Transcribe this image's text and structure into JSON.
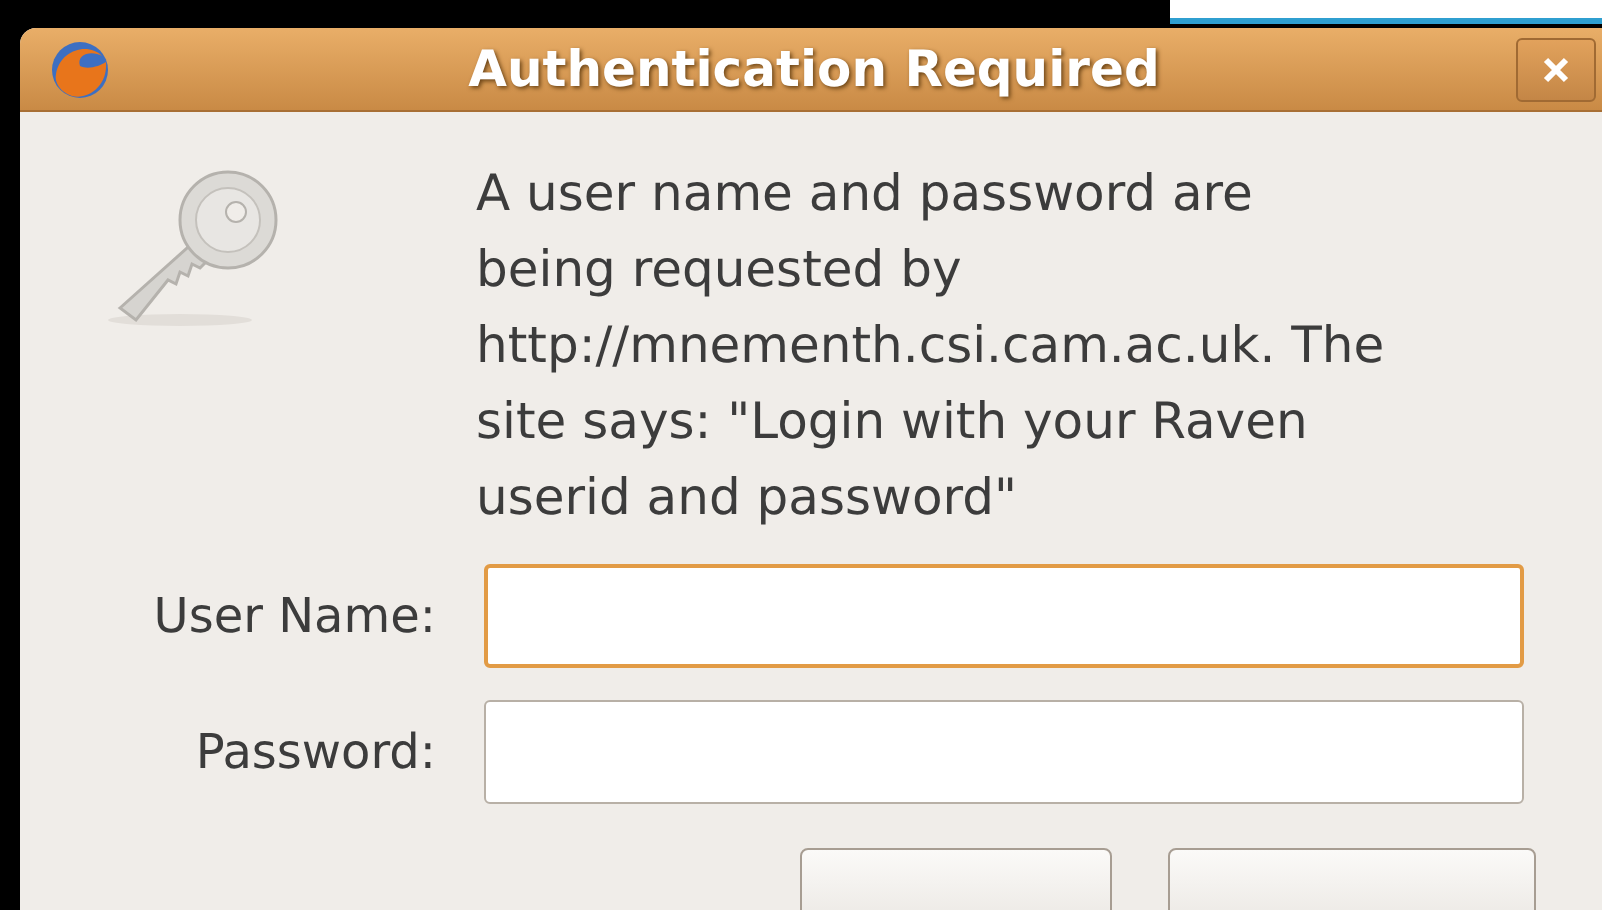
{
  "window": {
    "title": "Authentication Required"
  },
  "message": "A user name and password are being requested by http://mnementh.csi.cam.ac.uk. The site says: \"Login with your Raven userid and password\"",
  "fields": [
    {
      "label": "User Name:",
      "focused": true
    },
    {
      "label": "Password:",
      "focused": false
    }
  ]
}
